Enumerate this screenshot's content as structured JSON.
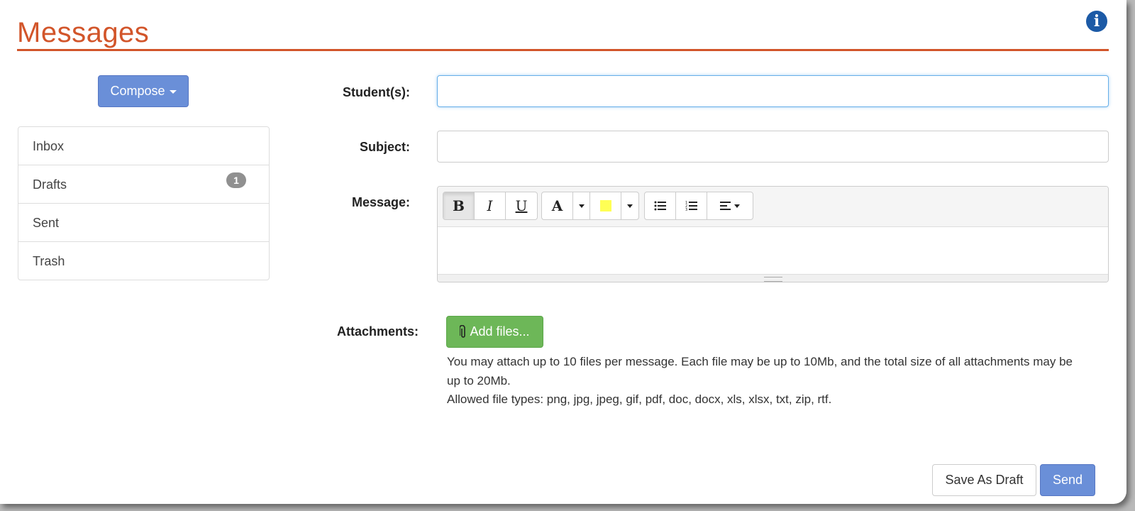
{
  "header": {
    "title": "Messages",
    "info_icon": "info-icon"
  },
  "sidebar": {
    "compose_label": "Compose",
    "folders": [
      {
        "label": "Inbox",
        "badge": ""
      },
      {
        "label": "Drafts",
        "badge": "1"
      },
      {
        "label": "Sent",
        "badge": ""
      },
      {
        "label": "Trash",
        "badge": ""
      }
    ]
  },
  "form": {
    "students_label": "Student(s):",
    "students_value": "",
    "subject_label": "Subject:",
    "subject_value": "",
    "message_label": "Message:",
    "message_value": "",
    "toolbar": {
      "bold": "B",
      "italic": "I",
      "underline": "U",
      "font_color": "A",
      "highlight_color": "#ffff55"
    },
    "attachments_label": "Attachments:",
    "add_files_label": "Add files...",
    "help_line1": "You may attach up to 10 files per message. Each file may be up to 10Mb, and the total size of all attachments may be up to 20Mb.",
    "help_line2": "Allowed file types: png, jpg, jpeg, gif, pdf, doc, docx, xls, xlsx, txt, zip, rtf."
  },
  "actions": {
    "save_draft": "Save As Draft",
    "send": "Send"
  },
  "colors": {
    "accent": "#d2552a",
    "primary": "#6a8fd8",
    "success": "#6db758"
  }
}
